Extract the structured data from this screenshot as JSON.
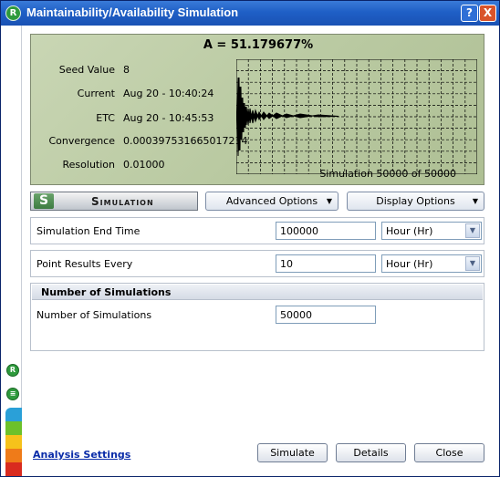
{
  "window": {
    "title": "Maintainability/Availability Simulation",
    "help_label": "?",
    "close_label": "X"
  },
  "display": {
    "availability": "A = 51.179677%",
    "fields": [
      {
        "label": "Seed Value",
        "value": "8"
      },
      {
        "label": "Current",
        "value": "Aug 20 - 10:40:24"
      },
      {
        "label": "ETC",
        "value": "Aug 20 - 10:45:53"
      },
      {
        "label": "Convergence",
        "value": "0.000397531665017214"
      },
      {
        "label": "Resolution",
        "value": "0.01000"
      }
    ],
    "simulation_count": "Simulation 50000 of 50000"
  },
  "toolbar": {
    "logo_letter": "S",
    "logo_text": "Simulation",
    "advanced_options": "Advanced Options",
    "display_options": "Display Options"
  },
  "settings": {
    "end_time": {
      "label": "Simulation End Time",
      "value": "100000",
      "unit": "Hour (Hr)"
    },
    "point_results": {
      "label": "Point Results Every",
      "value": "10",
      "unit": "Hour (Hr)"
    }
  },
  "num_sims": {
    "header": "Number of Simulations",
    "label": "Number of Simulations",
    "value": "50000"
  },
  "footer": {
    "link": "Analysis Settings",
    "simulate": "Simulate",
    "details": "Details",
    "close": "Close"
  },
  "colors": {
    "stripes": [
      "#2aa0d8",
      "#6cc12a",
      "#f6c21b",
      "#ef7b19",
      "#d92b1f"
    ]
  }
}
